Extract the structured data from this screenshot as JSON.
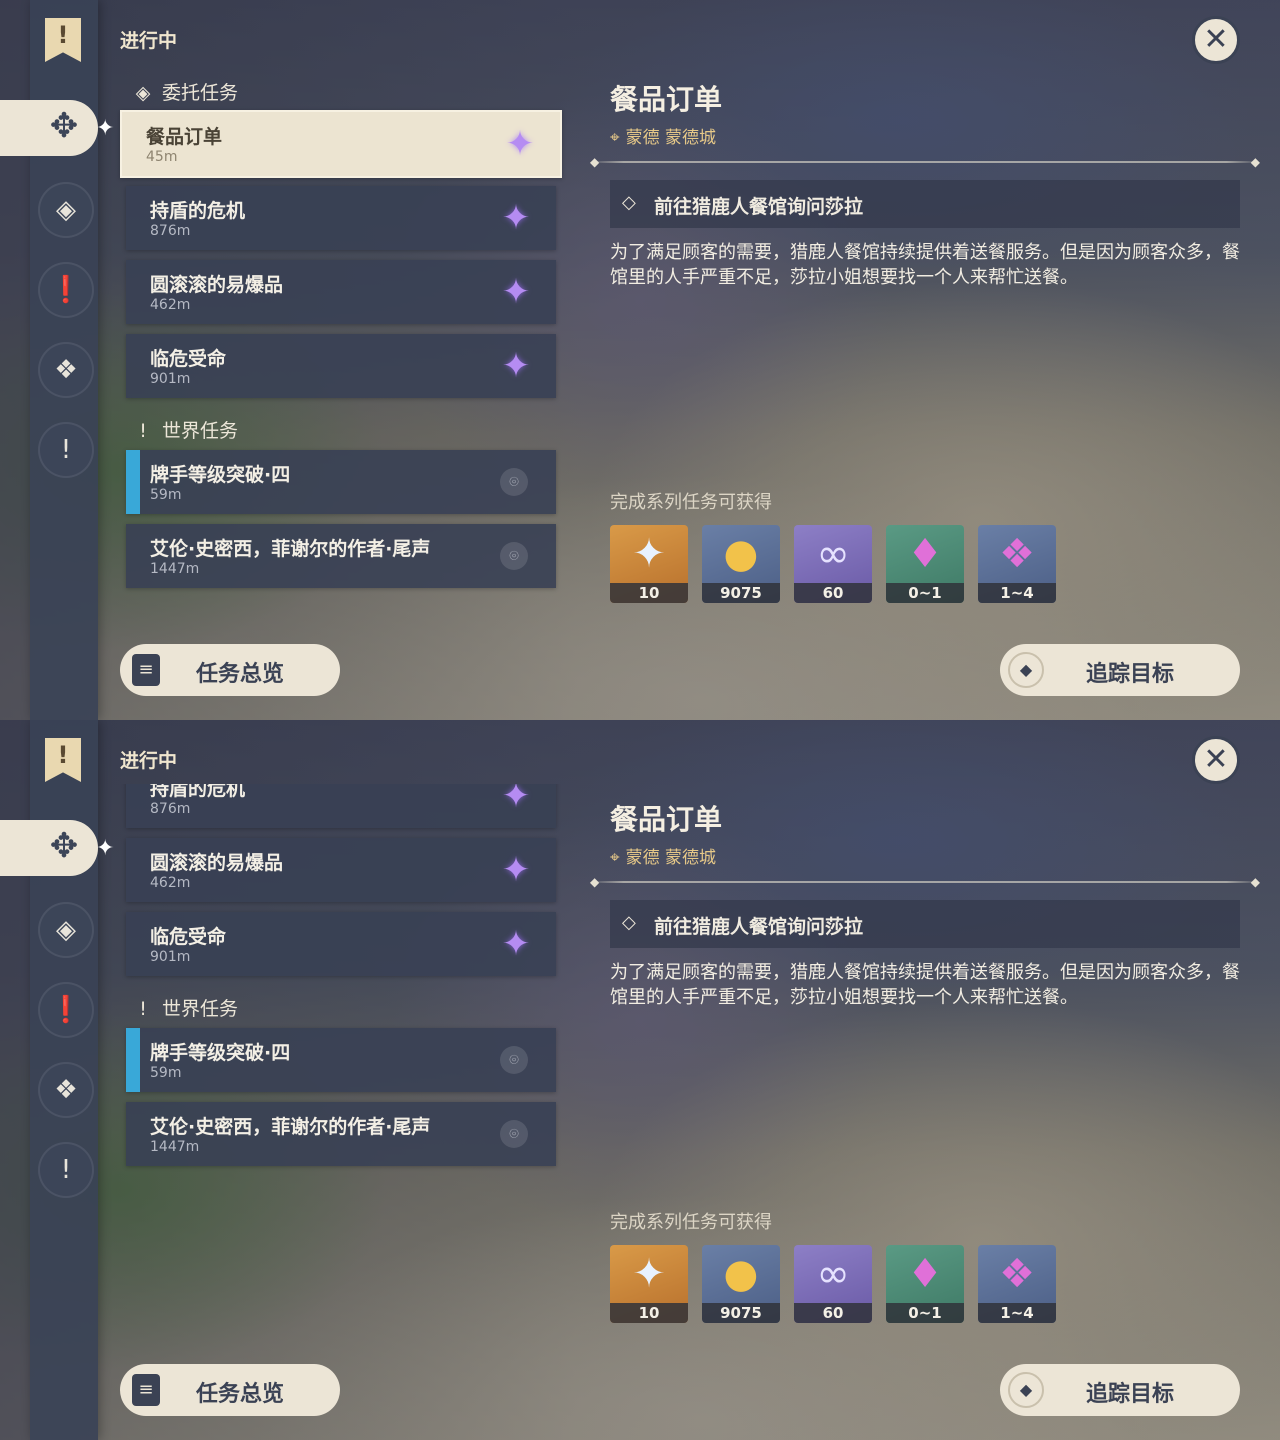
{
  "panels": [
    {
      "header": {
        "status": "进行中"
      },
      "categories": {
        "commission": "委托任务",
        "world": "世界任务"
      },
      "quests": [
        {
          "name": "餐品订单",
          "distance": "45m"
        },
        {
          "name": "持盾的危机",
          "distance": "876m"
        },
        {
          "name": "圆滚滚的易爆品",
          "distance": "462m"
        },
        {
          "name": "临危受命",
          "distance": "901m"
        }
      ],
      "world_quests": [
        {
          "name": "牌手等级突破·四",
          "distance": "59m"
        },
        {
          "name": "艾伦·史密西，菲谢尔的作者·尾声",
          "distance": "1447m"
        }
      ],
      "detail": {
        "title": "餐品订单",
        "location": "蒙德 蒙德城",
        "objective": "前往猎鹿人餐馆询问莎拉",
        "description": "为了满足顾客的需要，猎鹿人餐馆持续提供着送餐服务。但是因为顾客众多，餐馆里的人手严重不足，莎拉小姐想要找一个人来帮忙送餐。",
        "rewards_title": "完成系列任务可获得",
        "rewards": [
          {
            "icon": "primogem-icon",
            "count": "10"
          },
          {
            "icon": "mora-icon",
            "count": "9075"
          },
          {
            "icon": "friendship-exp-icon",
            "count": "60"
          },
          {
            "icon": "crystal-icon",
            "count": "0~1"
          },
          {
            "icon": "crystal-cluster-icon",
            "count": "1~4"
          }
        ]
      },
      "buttons": {
        "overview": "任务总览",
        "track": "追踪目标"
      }
    },
    {
      "header": {
        "status": "进行中"
      },
      "categories": {
        "world": "世界任务"
      },
      "quests_partial": {
        "name": "持盾的危机",
        "distance": "876m"
      },
      "quests": [
        {
          "name": "圆滚滚的易爆品",
          "distance": "462m"
        },
        {
          "name": "临危受命",
          "distance": "901m"
        }
      ],
      "world_quests": [
        {
          "name": "牌手等级突破·四",
          "distance": "59m"
        },
        {
          "name": "艾伦·史密西，菲谢尔的作者·尾声",
          "distance": "1447m"
        }
      ],
      "detail": {
        "title": "餐品订单",
        "location": "蒙德 蒙德城",
        "objective": "前往猎鹿人餐馆询问莎拉",
        "description": "为了满足顾客的需要，猎鹿人餐馆持续提供着送餐服务。但是因为顾客众多，餐馆里的人手严重不足，莎拉小姐想要找一个人来帮忙送餐。",
        "rewards_title": "完成系列任务可获得",
        "rewards": [
          {
            "icon": "primogem-icon",
            "count": "10"
          },
          {
            "icon": "mora-icon",
            "count": "9075"
          },
          {
            "icon": "friendship-exp-icon",
            "count": "60"
          },
          {
            "icon": "crystal-icon",
            "count": "0~1"
          },
          {
            "icon": "crystal-cluster-icon",
            "count": "1~4"
          }
        ]
      },
      "buttons": {
        "overview": "任务总览",
        "track": "追踪目标"
      }
    }
  ],
  "colors": {
    "cream": "#ece5d6",
    "slate": "#3b4254",
    "gold_text": "#e6c888",
    "quest_star": "#b58cf2",
    "world_bar": "#39a8d8"
  }
}
